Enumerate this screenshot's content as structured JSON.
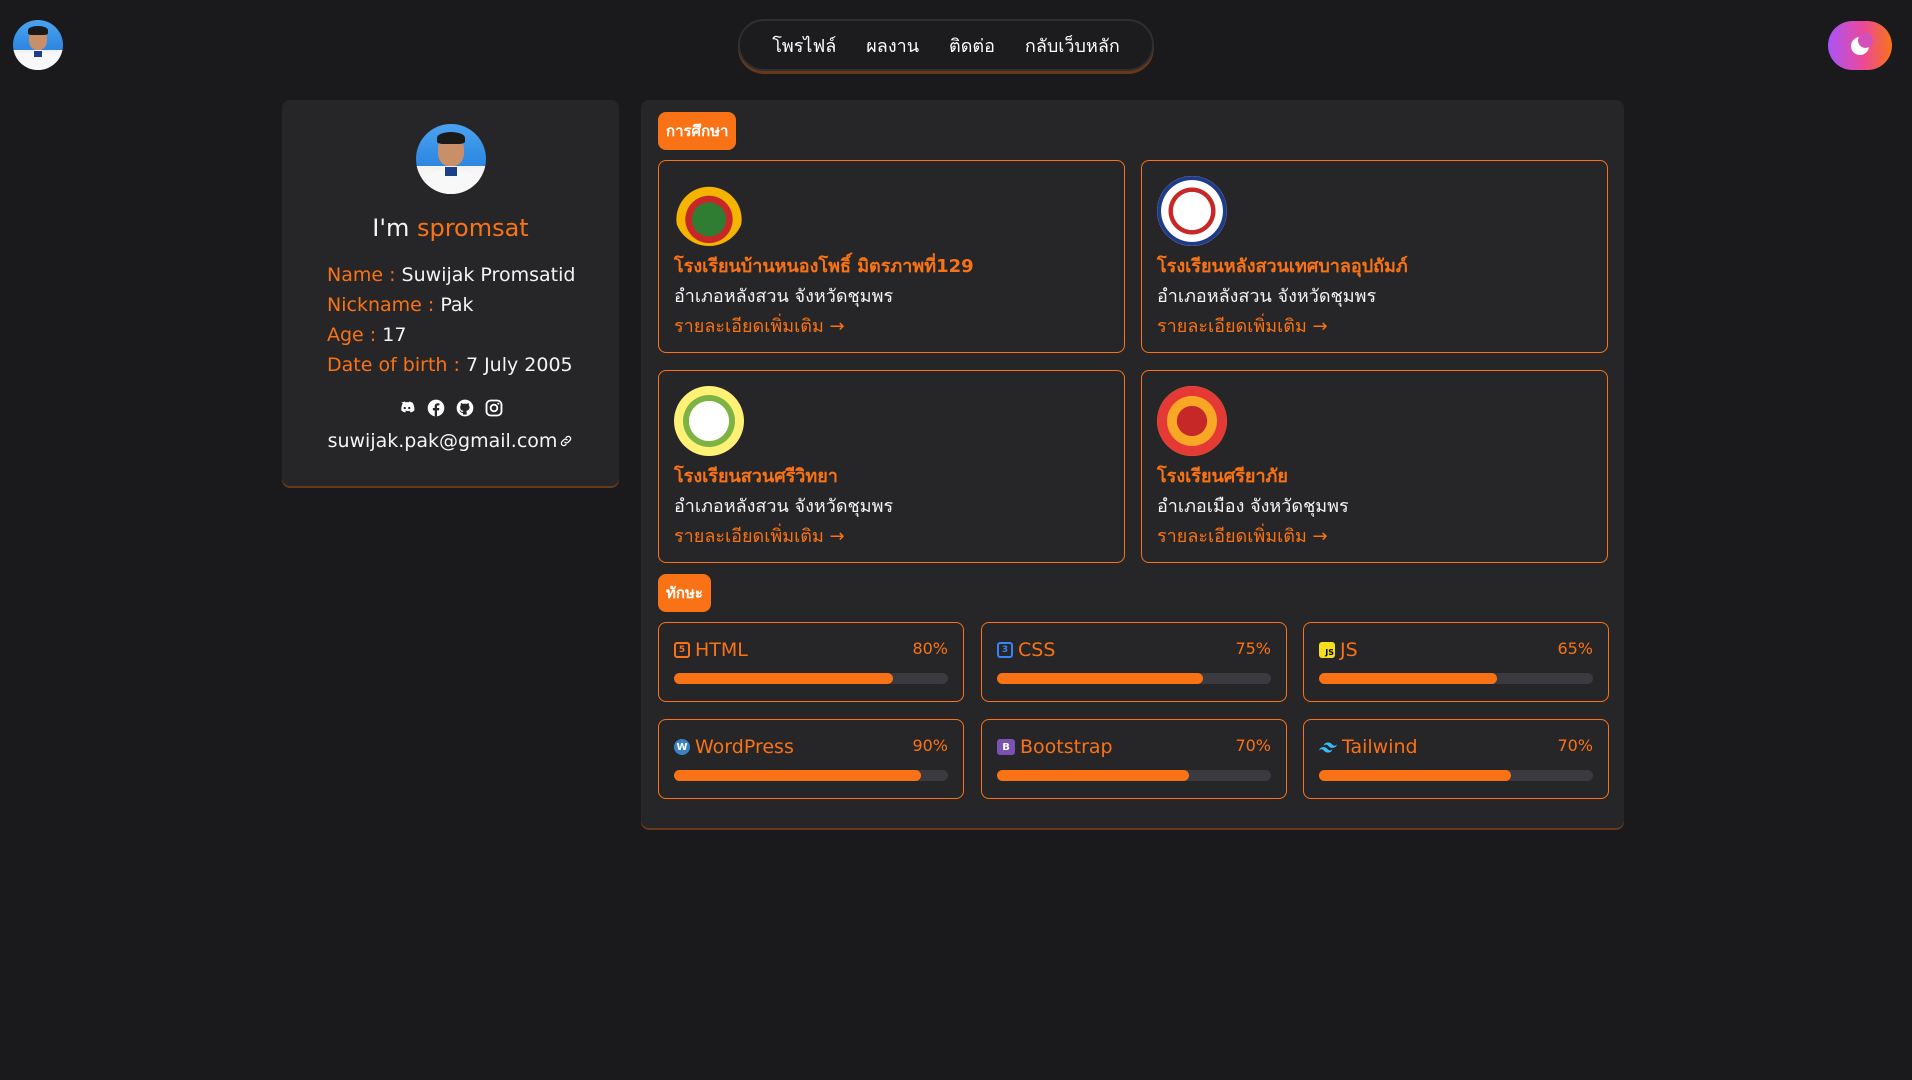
{
  "nav": {
    "items": [
      "โพรไฟล์",
      "ผลงาน",
      "ติดต่อ",
      "กลับเว็บหลัก"
    ]
  },
  "profile": {
    "greeting": "I'm ",
    "handle": "spromsat",
    "fields": [
      {
        "key": "Name : ",
        "value": "Suwijak Promsatid"
      },
      {
        "key": "Nickname : ",
        "value": "Pak"
      },
      {
        "key": "Age : ",
        "value": "17"
      },
      {
        "key": "Date of birth : ",
        "value": "7 July 2005"
      }
    ],
    "socials": [
      "discord-icon",
      "facebook-icon",
      "github-icon",
      "instagram-icon"
    ],
    "email": "suwijak.pak@gmail.com"
  },
  "education": {
    "title": "การศึกษา",
    "schools": [
      {
        "name": "โรงเรียนบ้านหนองโพธิ์ มิตรภาพที่129",
        "district": "อำเภอหลังสวน จังหวัดชุมพร",
        "more": "รายละเอียดเพิ่มเติม"
      },
      {
        "name": "โรงเรียนหลังสวนเทศบาลอุปถัมภ์",
        "district": "อำเภอหลังสวน จังหวัดชุมพร",
        "more": "รายละเอียดเพิ่มเติม"
      },
      {
        "name": "โรงเรียนสวนศรีวิทยา",
        "district": "อำเภอหลังสวน จังหวัดชุมพร",
        "more": "รายละเอียดเพิ่มเติม"
      },
      {
        "name": "โรงเรียนศรียาภัย",
        "district": "อำเภอเมือง จังหวัดชุมพร",
        "more": "รายละเอียดเพิ่มเติม"
      }
    ]
  },
  "skills": {
    "title": "ทักษะ",
    "items": [
      {
        "name": "HTML",
        "pct": "80%",
        "level": 0.8,
        "color": "#e34f26"
      },
      {
        "name": "CSS",
        "pct": "75%",
        "level": 0.75,
        "color": "#1572b6"
      },
      {
        "name": "JS",
        "pct": "65%",
        "level": 0.65,
        "color": "#f7df1e"
      },
      {
        "name": "WordPress",
        "pct": "90%",
        "level": 0.9,
        "color": "#21759b"
      },
      {
        "name": "Bootstrap",
        "pct": "70%",
        "level": 0.7,
        "color": "#7952b3"
      },
      {
        "name": "Tailwind",
        "pct": "70%",
        "level": 0.7,
        "color": "#38bdf8"
      }
    ]
  },
  "accent": "#f97316"
}
